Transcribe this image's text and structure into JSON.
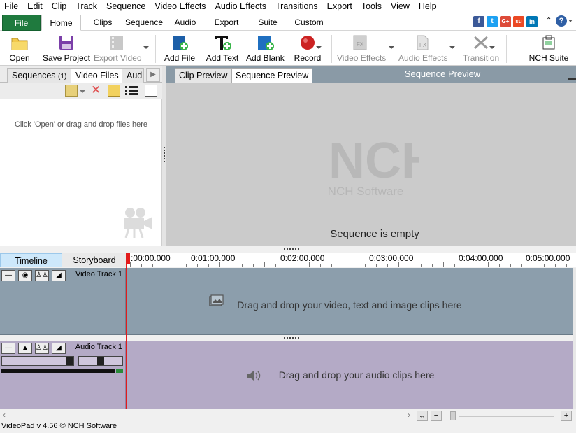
{
  "menu": [
    "File",
    "Edit",
    "Clip",
    "Track",
    "Sequence",
    "Video Effects",
    "Audio Effects",
    "Transitions",
    "Export",
    "Tools",
    "View",
    "Help"
  ],
  "ribbon_tabs": [
    "File",
    "Home",
    "Clips",
    "Sequence",
    "Audio",
    "Export",
    "Suite",
    "Custom"
  ],
  "social_icons": [
    "facebook-icon",
    "twitter-icon",
    "googleplus-icon",
    "stumbleupon-icon",
    "linkedin-icon"
  ],
  "social_glyphs": [
    "f",
    "t",
    "G+",
    "su",
    "in"
  ],
  "social_colors": [
    "#3b5998",
    "#1da1f2",
    "#dd4b39",
    "#eb4924",
    "#0077b5"
  ],
  "toolbar": {
    "open": "Open",
    "save_project": "Save Project",
    "export_video": "Export Video",
    "add_file": "Add File",
    "add_text": "Add Text",
    "add_blank": "Add Blank",
    "record": "Record",
    "video_effects": "Video Effects",
    "audio_effects": "Audio Effects",
    "transition": "Transition",
    "nch_suite": "NCH Suite"
  },
  "left_panel": {
    "tabs": [
      "Sequences",
      "Video Files",
      "Audi"
    ],
    "sequences_count": "(1)",
    "hint": "Click 'Open' or drag and drop files here"
  },
  "preview": {
    "tabs": [
      "Clip Preview",
      "Sequence Preview"
    ],
    "title": "Sequence Preview",
    "logo_text": "NCH",
    "logo_sub": "NCH Software",
    "empty_message": "Sequence is empty"
  },
  "timeline": {
    "tabs": [
      "Timeline",
      "Storyboard"
    ],
    "ruler": [
      ":00:00.000",
      "0:01:00.000",
      "0:02:00.000",
      "0:03:00.000",
      "0:04:00.000",
      "0:05:00.000"
    ],
    "video_track": {
      "name": "Video Track 1",
      "hint": "Drag and drop your video, text and image clips here"
    },
    "audio_track": {
      "name": "Audio Track 1",
      "hint": "Drag and drop your audio clips here"
    }
  },
  "colors": {
    "file_tab": "#1f7a3e",
    "video_track_bg": "#8c9eac",
    "audio_track_bg": "#b4aac6",
    "timeline_tab_active": "#cde8fb",
    "playhead": "#e21b1b",
    "preview_header": "#8a9aa6"
  },
  "status_text": "VideoPad v 4.56 © NCH Software"
}
